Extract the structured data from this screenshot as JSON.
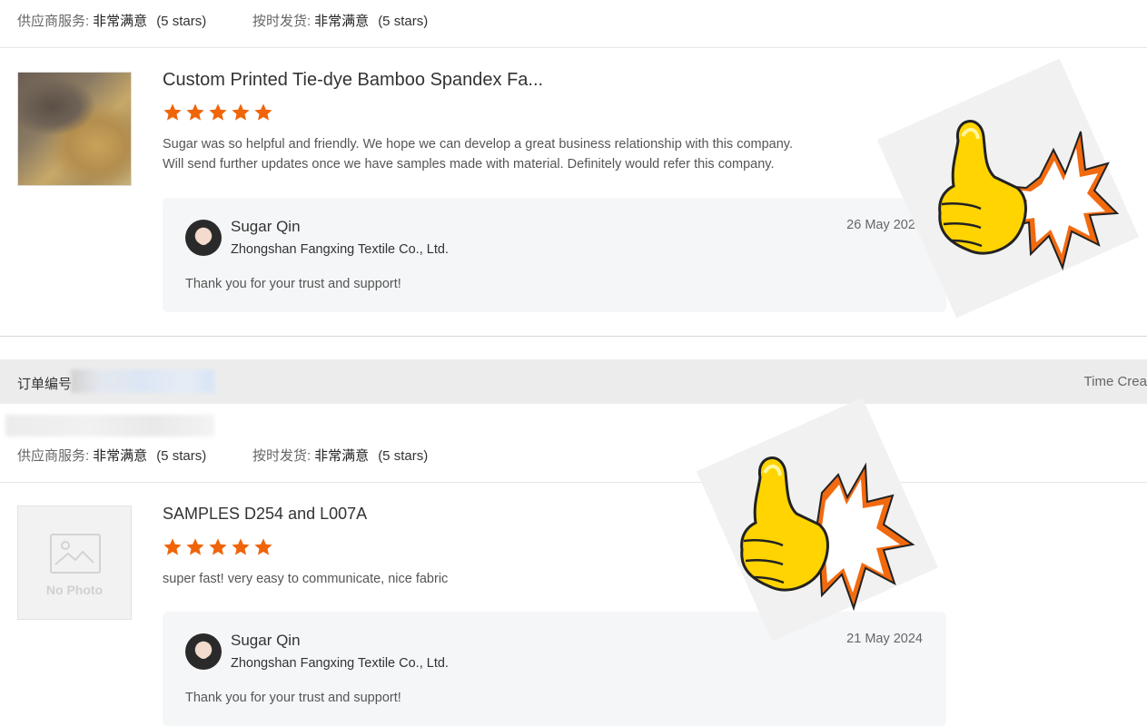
{
  "rating_labels": {
    "supplier_service": "供应商服务:",
    "on_time_delivery": "按时发货:",
    "value": "非常满意",
    "stars": "(5 stars)"
  },
  "reviews": [
    {
      "product_title": "Custom Printed Tie-dye Bamboo Spandex Fa...",
      "rating": 5,
      "thumbnail": "product-photo",
      "text_lines": [
        "Sugar was so helpful and friendly.  We hope we can develop a great business relationship with this company.",
        "Will send further updates once we have samples made with material.  Definitely would refer this company."
      ],
      "reply": {
        "name": "Sugar Qin",
        "company": "Zhongshan Fangxing Textile Co., Ltd.",
        "date": "26 May 2024",
        "text": "Thank you for your trust and support!"
      }
    },
    {
      "product_title": "SAMPLES D254 and L007A",
      "rating": 5,
      "thumbnail": "no-photo",
      "no_photo_label": "No Photo",
      "text_lines": [
        "super fast! very easy to communicate, nice fabric"
      ],
      "reply": {
        "name": "Sugar Qin",
        "company": "Zhongshan Fangxing Textile Co., Ltd.",
        "date": "21 May 2024",
        "text": "Thank you for your trust and support!"
      }
    }
  ],
  "order_bar": {
    "order_label": "订单编号",
    "time_label": "Time Crea"
  },
  "colors": {
    "star": "#f0640a",
    "thumb_yellow": "#ffd400",
    "burst_orange": "#f26a10"
  },
  "icons": {
    "star": "star-icon",
    "thumbs_up": "thumbs-up-sticker",
    "no_photo": "image-placeholder-icon"
  }
}
